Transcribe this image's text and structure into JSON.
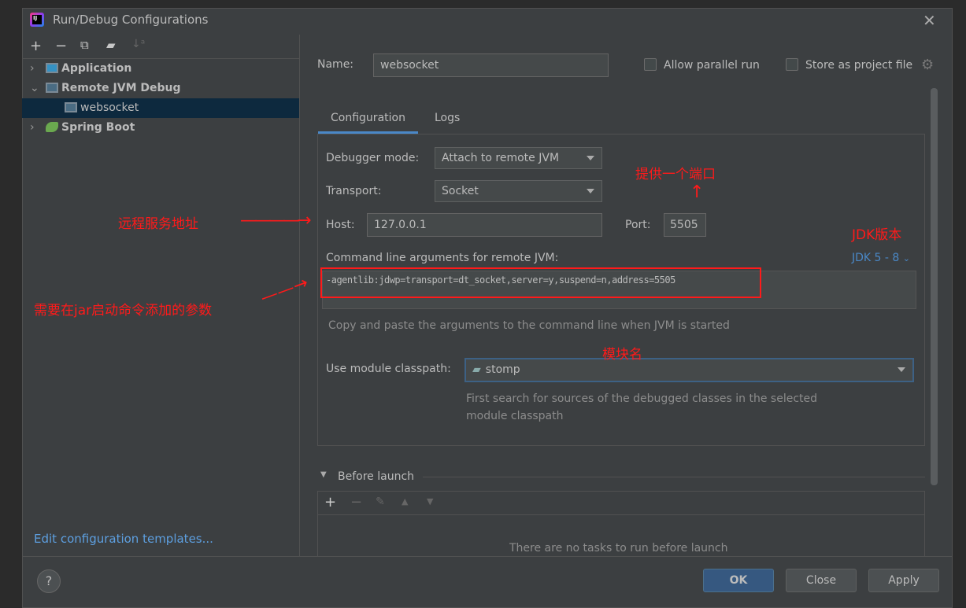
{
  "dialog": {
    "title": "Run/Debug Configurations",
    "logo_text": "IJ"
  },
  "toolbar": [
    "add-icon",
    "remove-icon",
    "copy-icon",
    "folder-add-icon",
    "sort-icon"
  ],
  "tree": [
    {
      "label": "Application",
      "expanded": false
    },
    {
      "label": "Remote JVM Debug",
      "expanded": true,
      "children": [
        {
          "label": "websocket",
          "selected": true
        }
      ]
    },
    {
      "label": "Spring Boot",
      "expanded": false
    }
  ],
  "edit_templates": "Edit configuration templates...",
  "name_label": "Name:",
  "name_value": "websocket",
  "allow_parallel": "Allow parallel run",
  "store_project": "Store as project file",
  "tabs": [
    "Configuration",
    "Logs"
  ],
  "debugger_mode_label": "Debugger mode:",
  "debugger_mode": "Attach to remote JVM",
  "transport_label": "Transport:",
  "transport": "Socket",
  "host_label": "Host:",
  "host": "127.0.0.1",
  "port_label": "Port:",
  "port": "5505",
  "cmd_label": "Command line arguments for remote JVM:",
  "jdk": "JDK 5 - 8",
  "cmd_value": "-agentlib:jdwp=transport=dt_socket,server=y,suspend=n,address=5505",
  "cmd_hint": "Copy and paste the arguments to the command line when JVM is started",
  "module_label": "Use module classpath:",
  "module": "stomp",
  "module_hint": "First search for sources of the debugged classes in the selected module classpath",
  "before_launch": "Before launch",
  "no_tasks": "There are no tasks to run before launch",
  "buttons": {
    "help": "?",
    "ok": "OK",
    "close": "Close",
    "apply": "Apply"
  },
  "annotations": {
    "port": "提供一个端口",
    "host": "远程服务地址",
    "jdk": "JDK版本",
    "args": "需要在jar启动命令添加的参数",
    "module": "模块名"
  },
  "colors": {
    "accent": "#4a88c7",
    "annotation": "#ff1a1a",
    "selected": "#0d293e"
  }
}
